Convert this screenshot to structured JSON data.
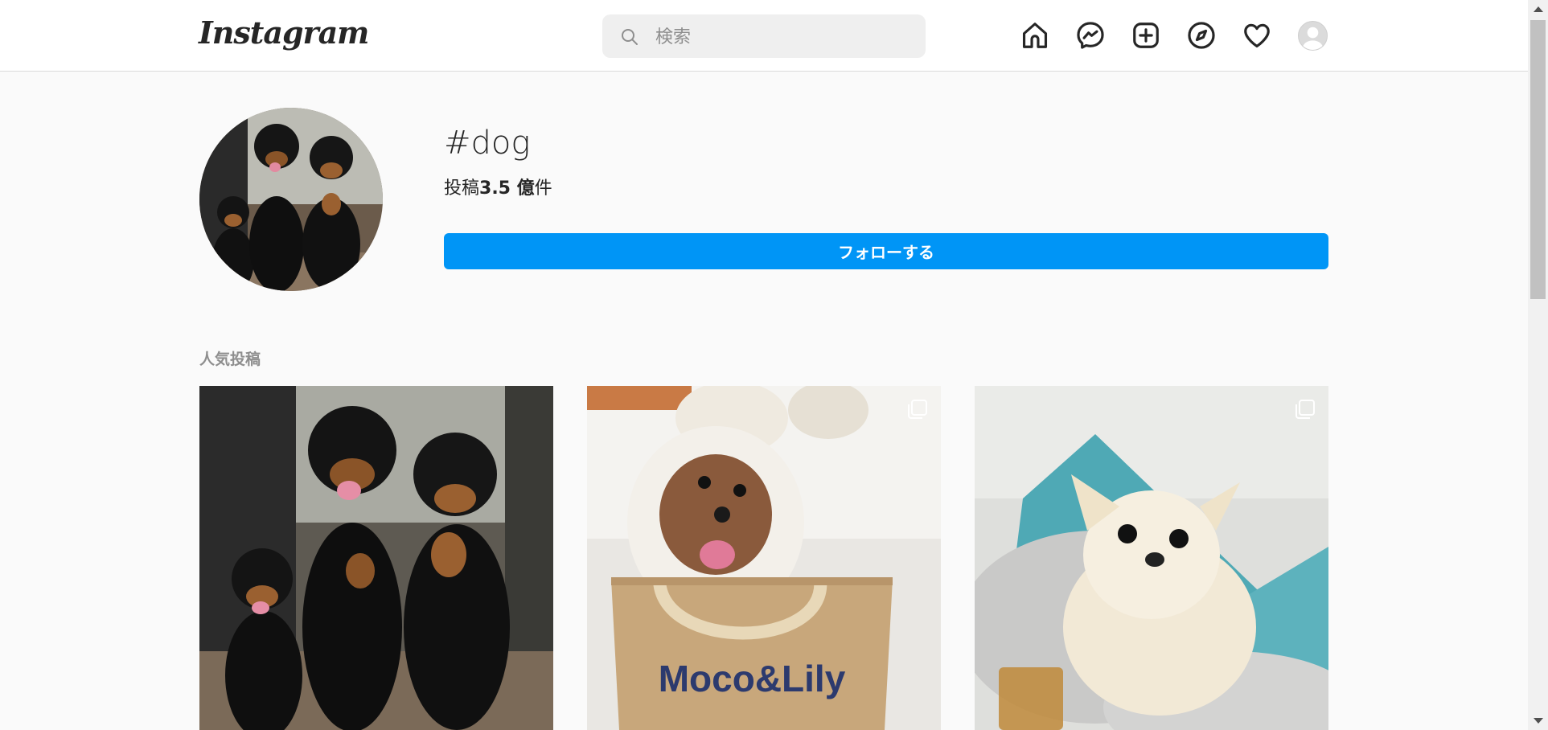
{
  "topbar": {
    "logo": "Instagram",
    "search_placeholder": "検索",
    "icons": [
      "home-icon",
      "messenger-icon",
      "new-post-icon",
      "explore-icon",
      "activity-heart-icon",
      "profile-avatar"
    ]
  },
  "hashtag": {
    "title": "#dog",
    "posts_prefix": "投稿",
    "posts_count": "3.5 億",
    "posts_suffix": "件",
    "follow_label": "フォローする"
  },
  "section": {
    "top_posts_label": "人気投稿"
  },
  "posts": [
    {
      "id": "post-1",
      "multi": false,
      "bag_text": ""
    },
    {
      "id": "post-2",
      "multi": true,
      "bag_text": "Moco&Lily"
    },
    {
      "id": "post-3",
      "multi": true,
      "bag_text": ""
    }
  ],
  "colors": {
    "accent": "#0095f6",
    "background": "#fafafa",
    "text": "#262626",
    "secondary_text": "#8e8e8e"
  }
}
